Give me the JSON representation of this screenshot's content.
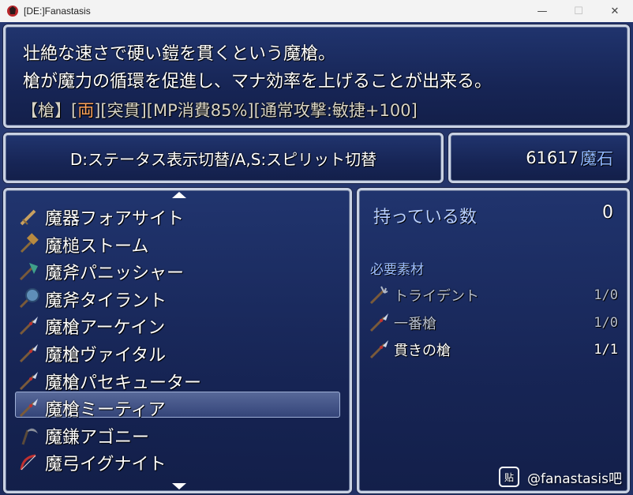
{
  "window": {
    "title": "[DE:]Fanastasis",
    "minimize_glyph": "—",
    "maximize_glyph": "☐",
    "close_glyph": "✕"
  },
  "description": {
    "line1": "壮絶な速さで硬い鎧を貫くという魔槍。",
    "line2": "槍が魔力の循環を促進し、マナ効率を上げることが出来る。",
    "tags": [
      {
        "text": "【槍】",
        "highlight": false
      },
      {
        "text": "[",
        "highlight": false
      },
      {
        "text": "両",
        "highlight": true
      },
      {
        "text": "][突貫][MP消費85%][通常攻撃:敏捷+100]",
        "highlight": false
      }
    ]
  },
  "help": {
    "text": "D:ステータス表示切替/A,S:スピリット切替"
  },
  "gold": {
    "amount": "61617",
    "unit": "魔石"
  },
  "item_list": {
    "selected_index": 7,
    "items": [
      {
        "label": "魔器フォアサイト",
        "icon": "dagger-icon"
      },
      {
        "label": "魔槌ストーム",
        "icon": "hammer-icon"
      },
      {
        "label": "魔斧パニッシャー",
        "icon": "axe-icon"
      },
      {
        "label": "魔斧タイラント",
        "icon": "battleaxe-icon"
      },
      {
        "label": "魔槍アーケイン",
        "icon": "spear-icon"
      },
      {
        "label": "魔槍ヴァイタル",
        "icon": "spear-icon"
      },
      {
        "label": "魔槍パセキューター",
        "icon": "spear-icon"
      },
      {
        "label": "魔槍ミーティア",
        "icon": "spear-icon"
      },
      {
        "label": "魔鎌アゴニー",
        "icon": "scythe-icon"
      },
      {
        "label": "魔弓イグナイト",
        "icon": "bow-icon"
      }
    ]
  },
  "detail": {
    "owned_label": "持っている数",
    "owned_count": "0",
    "materials_heading": "必要素材",
    "materials": [
      {
        "name": "トライデント",
        "qty": "1/0",
        "enough": false,
        "icon": "trident-icon"
      },
      {
        "name": "一番槍",
        "qty": "1/0",
        "enough": false,
        "icon": "spear-icon"
      },
      {
        "name": "貫きの槍",
        "qty": "1/1",
        "enough": true,
        "icon": "spear-icon"
      }
    ]
  },
  "watermark": {
    "icon_text": "贴",
    "text": "@fanastasis吧"
  },
  "colors": {
    "window_bg": "#1a2a5a",
    "border": "#c9d2e3",
    "tag_highlight": "#ffa35a",
    "disabled_text": "#b7bfcf",
    "gold_unit": "#8fb7ff"
  }
}
